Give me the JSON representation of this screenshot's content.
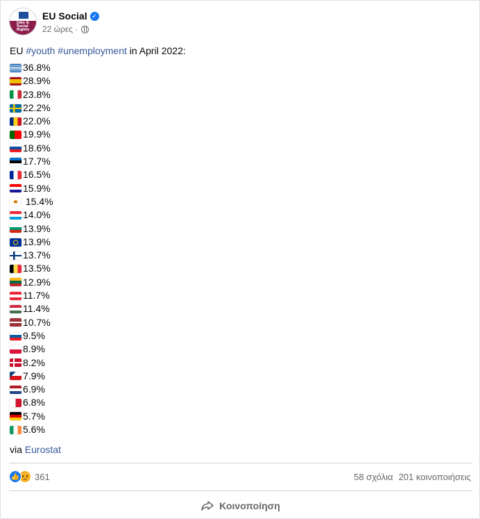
{
  "post": {
    "page_name": "EU Social",
    "timestamp": "22 ώρες",
    "separator": "·",
    "avatar_text": "Jobs & Social Rights",
    "intro": {
      "prefix": "EU ",
      "hashtag1": "#youth",
      "space": " ",
      "hashtag2": "#unemployment",
      "suffix": " in April 2022:"
    },
    "rates": [
      {
        "flag": "greece",
        "value": "36.8%"
      },
      {
        "flag": "spain",
        "value": "28.9%"
      },
      {
        "flag": "italy",
        "value": "23.8%"
      },
      {
        "flag": "sweden",
        "value": "22.2%"
      },
      {
        "flag": "romania",
        "value": "22.0%"
      },
      {
        "flag": "portugal",
        "value": "19.9%"
      },
      {
        "flag": "slovakia",
        "value": "18.6%"
      },
      {
        "flag": "estonia",
        "value": "17.7%"
      },
      {
        "flag": "france",
        "value": "16.5%"
      },
      {
        "flag": "croatia",
        "value": "15.9%"
      },
      {
        "flag": "cyprus",
        "value": " 15.4%"
      },
      {
        "flag": "luxembourg",
        "value": "14.0%"
      },
      {
        "flag": "bulgaria",
        "value": "13.9%"
      },
      {
        "flag": "eu",
        "value": "13.9%"
      },
      {
        "flag": "finland",
        "value": "13.7%"
      },
      {
        "flag": "belgium",
        "value": "13.5%"
      },
      {
        "flag": "lithuania",
        "value": "12.9%"
      },
      {
        "flag": "austria",
        "value": "11.7%"
      },
      {
        "flag": "hungary",
        "value": "11.4%"
      },
      {
        "flag": "latvia",
        "value": "10.7%"
      },
      {
        "flag": "slovenia",
        "value": "9.5%"
      },
      {
        "flag": "poland",
        "value": "8.9%"
      },
      {
        "flag": "denmark",
        "value": "8.2%"
      },
      {
        "flag": "czechia",
        "value": "7.9%"
      },
      {
        "flag": "netherlands",
        "value": "6.9%"
      },
      {
        "flag": "malta",
        "value": "6.8%"
      },
      {
        "flag": "germany",
        "value": "5.7%"
      },
      {
        "flag": "ireland",
        "value": "5.6%"
      }
    ],
    "via_prefix": "via ",
    "via_link": "Eurostat"
  },
  "stats": {
    "reaction_count": "361",
    "comments": "58 σχόλια",
    "shares": "201 κοινοποιήσεις"
  },
  "actions": {
    "share_label": "Κοινοποίηση"
  },
  "colors": {
    "link": "#385898",
    "brand_blue": "#1877f2",
    "avatar_bg": "#8b1d4a",
    "divider": "#ced0d4"
  }
}
